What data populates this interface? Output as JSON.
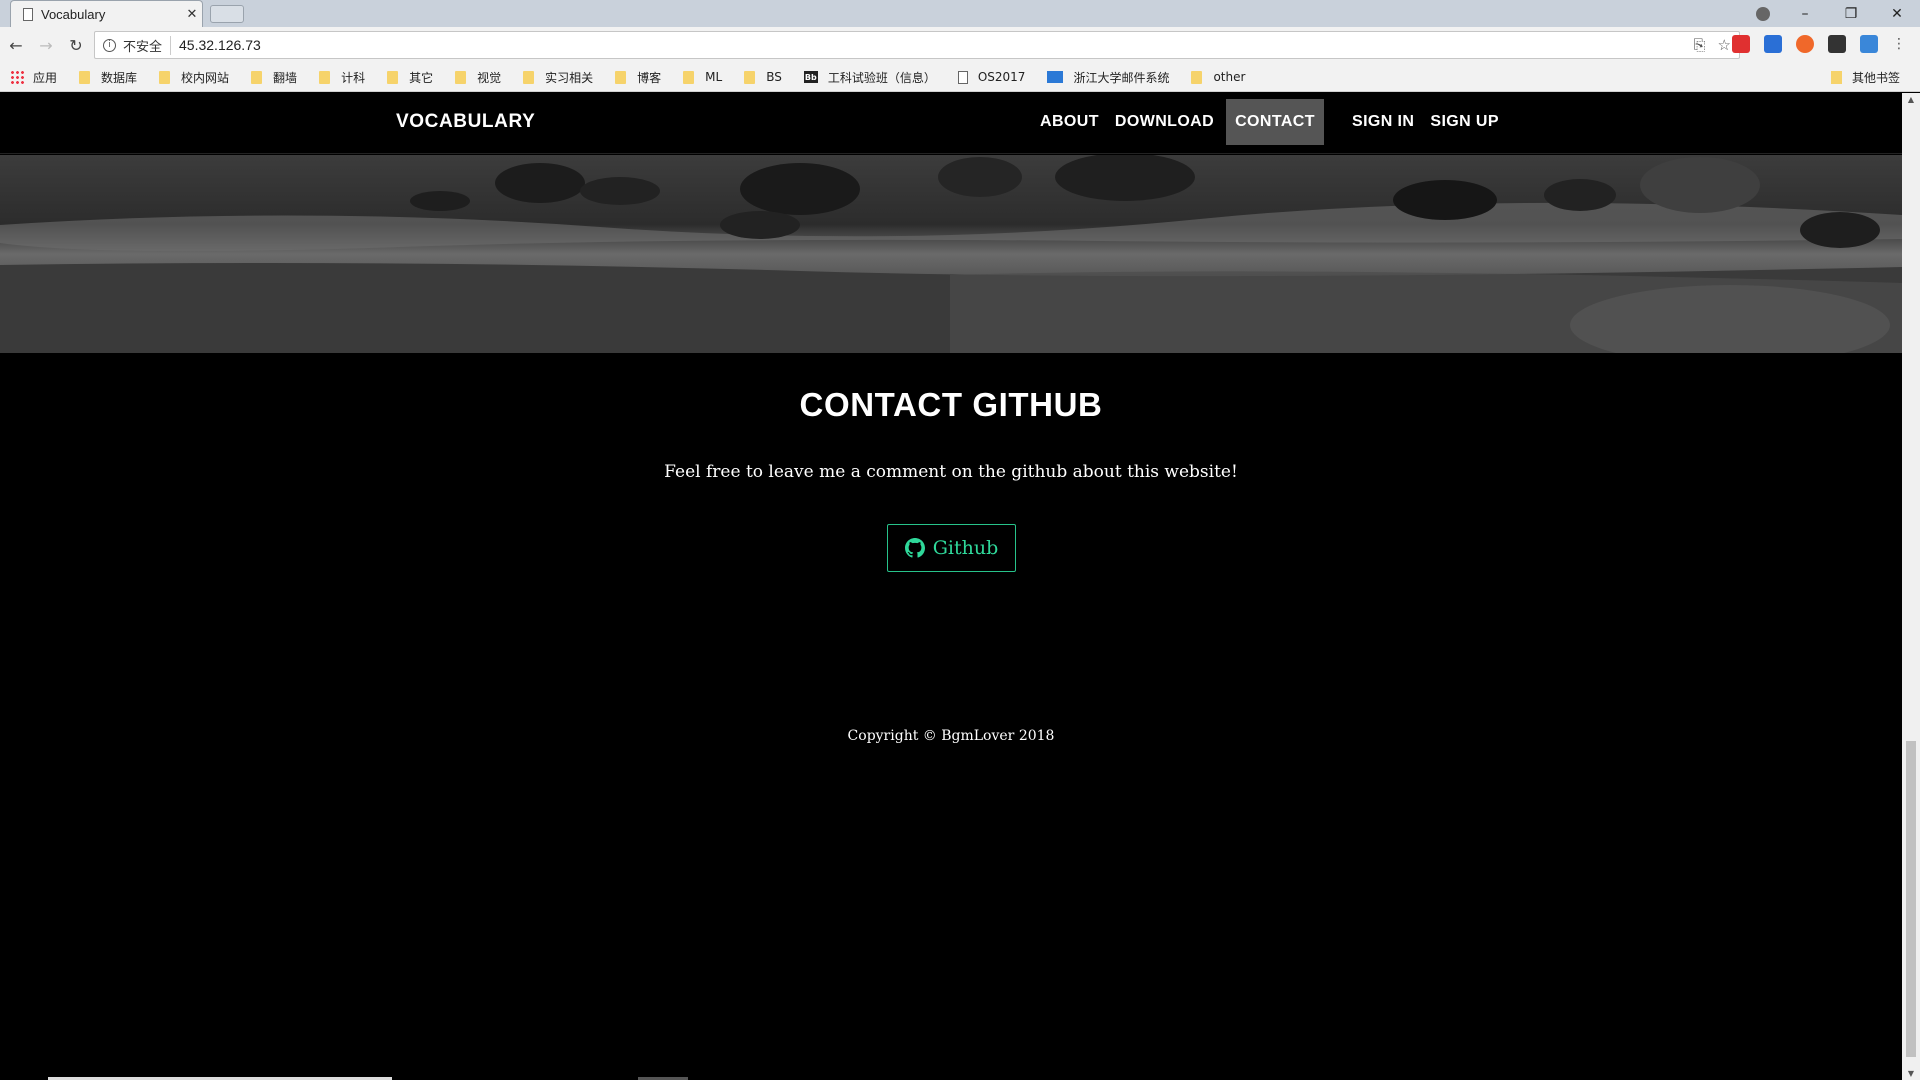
{
  "browser": {
    "tab_title": "Vocabulary",
    "tab_close": "✕",
    "window_controls": [
      "–",
      "❐",
      "✕"
    ],
    "insecure_label": "不安全",
    "url": "45.32.126.73",
    "bookmarks": [
      {
        "label": "应用",
        "icon": "apps-icon"
      },
      {
        "label": "数据库",
        "icon": "folder-icon"
      },
      {
        "label": "校内网站",
        "icon": "folder-icon"
      },
      {
        "label": "翻墙",
        "icon": "folder-icon"
      },
      {
        "label": "计科",
        "icon": "folder-icon"
      },
      {
        "label": "其它",
        "icon": "folder-icon"
      },
      {
        "label": "视觉",
        "icon": "folder-icon"
      },
      {
        "label": "实习相关",
        "icon": "folder-icon"
      },
      {
        "label": "博客",
        "icon": "folder-icon"
      },
      {
        "label": "ML",
        "icon": "folder-icon"
      },
      {
        "label": "BS",
        "icon": "folder-icon"
      },
      {
        "label": "工科试验班（信息）",
        "icon": "bb-icon"
      },
      {
        "label": "OS2017",
        "icon": "page-icon"
      },
      {
        "label": "浙江大学邮件系统",
        "icon": "mail-icon"
      },
      {
        "label": "other",
        "icon": "folder-icon"
      }
    ],
    "other_bookmarks": "其他书签"
  },
  "site": {
    "brand": "VOCABULARY",
    "nav": [
      "ABOUT",
      "DOWNLOAD",
      "CONTACT"
    ],
    "active_nav": "CONTACT",
    "auth": [
      "SIGN IN",
      "SIGN UP"
    ]
  },
  "contact": {
    "title": "CONTACT GITHUB",
    "text": "Feel free to leave me a comment on the github about this website!",
    "button_label": "Github",
    "button_color": "#2fd89a"
  },
  "footer": {
    "copyright": "Copyright © BgmLover 2018"
  }
}
